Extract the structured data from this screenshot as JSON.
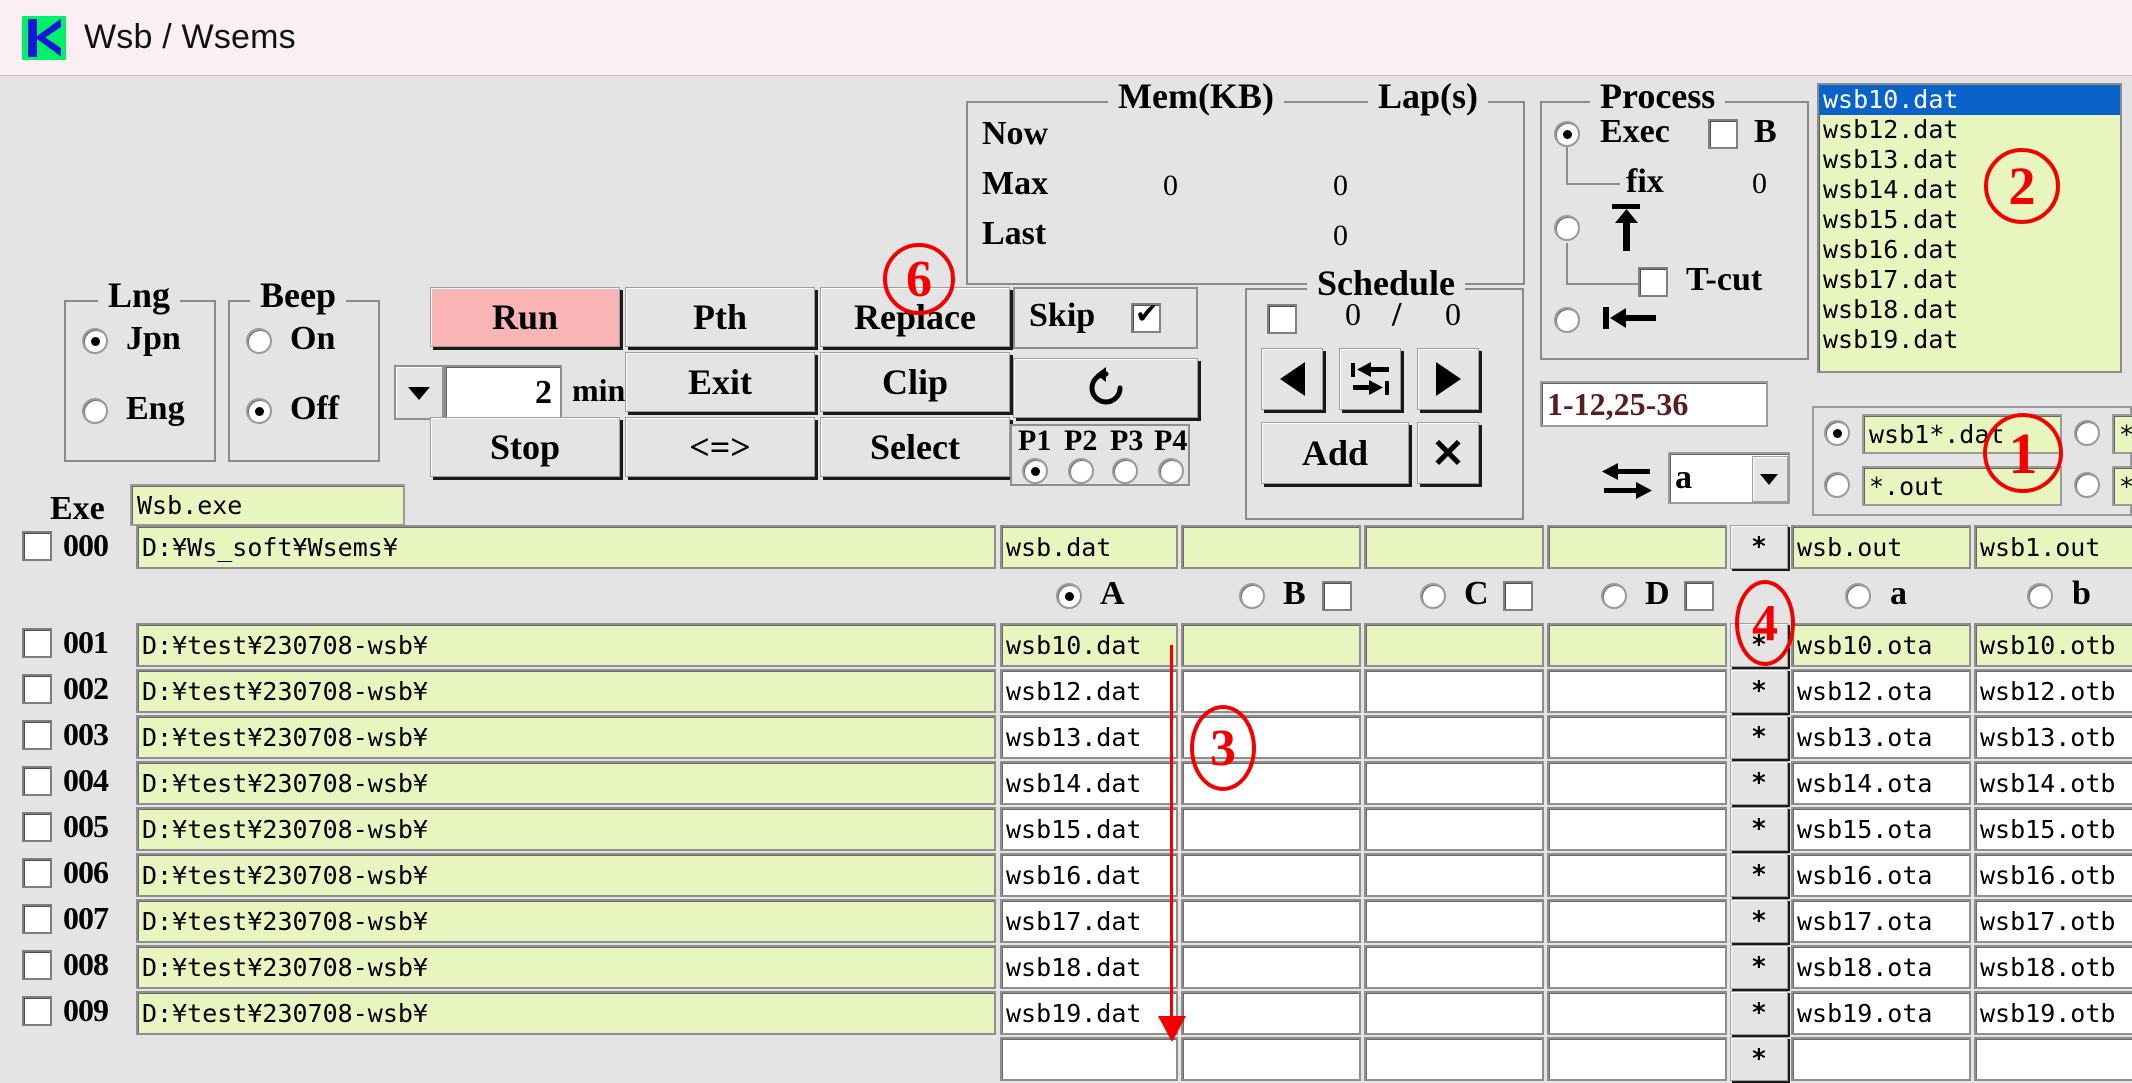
{
  "window": {
    "title": "Wsb / Wsems",
    "logo_icon": "k-logo-icon"
  },
  "mem_lap": {
    "title_mem": "Mem(KB)",
    "title_lap": "Lap(s)",
    "rows": [
      {
        "label": "Now",
        "mem": "",
        "lap": ""
      },
      {
        "label": "Max",
        "mem": "0",
        "lap": "0"
      },
      {
        "label": "Last",
        "mem": "",
        "lap": "0"
      }
    ]
  },
  "process": {
    "title": "Process",
    "exec_label": "Exec",
    "exec_selected": true,
    "b_label": "B",
    "b_checked": false,
    "fix_label": "fix",
    "fix_value": "0",
    "up_icon": "up-arrow-bar-icon",
    "up_selected": false,
    "tcut_label": "T-cut",
    "tcut_checked": false,
    "home_icon": "bar-left-arrow-icon",
    "home_selected": false,
    "range_value": "1-12,25-36",
    "swap_icon": "swap-arrows-icon",
    "suffix_value": "a"
  },
  "filelist": {
    "items": [
      "wsb10.dat",
      "wsb12.dat",
      "wsb13.dat",
      "wsb14.dat",
      "wsb15.dat",
      "wsb16.dat",
      "wsb17.dat",
      "wsb18.dat",
      "wsb19.dat"
    ],
    "selected_index": 0
  },
  "lng": {
    "title": "Lng",
    "options": [
      "Jpn",
      "Eng"
    ],
    "selected": "Jpn"
  },
  "beep": {
    "title": "Beep",
    "options": [
      "On",
      "Off"
    ],
    "selected": "Off"
  },
  "exe": {
    "label": "Exe",
    "value": "Wsb.exe"
  },
  "buttons": {
    "run": "Run",
    "pth": "Pth",
    "replace": "Replace",
    "exit": "Exit",
    "clip": "Clip",
    "stop": "Stop",
    "swap": "<=>",
    "select": "Select",
    "refresh_icon": "refresh-icon"
  },
  "timer": {
    "dropdown_icon": "chevron-down-icon",
    "value": "2",
    "unit": "min"
  },
  "skip": {
    "label": "Skip",
    "checked": true
  },
  "pset": {
    "options": [
      "P1",
      "P2",
      "P3",
      "P4"
    ],
    "selected": "P1"
  },
  "schedule": {
    "title": "Schedule",
    "enabled": false,
    "current": "0",
    "separator": "/",
    "total": "0",
    "prev_icon": "triangle-left-icon",
    "swap_icon": "swap-ends-icon",
    "next_icon": "triangle-right-icon",
    "add_label": "Add",
    "delete_icon": "x-icon"
  },
  "filter": {
    "rows": [
      {
        "pattern": "wsb1*.dat",
        "selected": true,
        "alt_selected": false,
        "alt_pattern": "*"
      },
      {
        "pattern": "*.out",
        "selected": false,
        "alt_selected": false,
        "alt_pattern": "*"
      }
    ]
  },
  "table": {
    "column_headers": {
      "a": "A",
      "b": "B",
      "c": "C",
      "d": "D",
      "a_selected": true,
      "b_selected": false,
      "c_selected": false,
      "d_selected": false,
      "b_checked": false,
      "c_checked": false,
      "d_checked": false,
      "out_a": "a",
      "out_b": "b",
      "out_a_selected": false,
      "out_b_selected": false
    },
    "header_row": {
      "no": "000",
      "checked": false,
      "path": "D:¥Ws_soft¥Wsems¥",
      "colA": "wsb.dat",
      "colB": "",
      "colC": "",
      "colD": "",
      "star": "*",
      "outA": "wsb.out",
      "outB": "wsb1.out",
      "highlight": true
    },
    "rows": [
      {
        "no": "001",
        "checked": false,
        "path": "D:¥test¥230708-wsb¥",
        "colA": "wsb10.dat",
        "colB": "",
        "colC": "",
        "colD": "",
        "star": "*",
        "outA": "wsb10.ota",
        "outB": "wsb10.otb",
        "highlight": true
      },
      {
        "no": "002",
        "checked": false,
        "path": "D:¥test¥230708-wsb¥",
        "colA": "wsb12.dat",
        "colB": "",
        "colC": "",
        "colD": "",
        "star": "*",
        "outA": "wsb12.ota",
        "outB": "wsb12.otb",
        "highlight": false
      },
      {
        "no": "003",
        "checked": false,
        "path": "D:¥test¥230708-wsb¥",
        "colA": "wsb13.dat",
        "colB": "",
        "colC": "",
        "colD": "",
        "star": "*",
        "outA": "wsb13.ota",
        "outB": "wsb13.otb",
        "highlight": false
      },
      {
        "no": "004",
        "checked": false,
        "path": "D:¥test¥230708-wsb¥",
        "colA": "wsb14.dat",
        "colB": "",
        "colC": "",
        "colD": "",
        "star": "*",
        "outA": "wsb14.ota",
        "outB": "wsb14.otb",
        "highlight": false
      },
      {
        "no": "005",
        "checked": false,
        "path": "D:¥test¥230708-wsb¥",
        "colA": "wsb15.dat",
        "colB": "",
        "colC": "",
        "colD": "",
        "star": "*",
        "outA": "wsb15.ota",
        "outB": "wsb15.otb",
        "highlight": false
      },
      {
        "no": "006",
        "checked": false,
        "path": "D:¥test¥230708-wsb¥",
        "colA": "wsb16.dat",
        "colB": "",
        "colC": "",
        "colD": "",
        "star": "*",
        "outA": "wsb16.ota",
        "outB": "wsb16.otb",
        "highlight": false
      },
      {
        "no": "007",
        "checked": false,
        "path": "D:¥test¥230708-wsb¥",
        "colA": "wsb17.dat",
        "colB": "",
        "colC": "",
        "colD": "",
        "star": "*",
        "outA": "wsb17.ota",
        "outB": "wsb17.otb",
        "highlight": false
      },
      {
        "no": "008",
        "checked": false,
        "path": "D:¥test¥230708-wsb¥",
        "colA": "wsb18.dat",
        "colB": "",
        "colC": "",
        "colD": "",
        "star": "*",
        "outA": "wsb18.ota",
        "outB": "wsb18.otb",
        "highlight": false
      },
      {
        "no": "009",
        "checked": false,
        "path": "D:¥test¥230708-wsb¥",
        "colA": "wsb19.dat",
        "colB": "",
        "colC": "",
        "colD": "",
        "star": "*",
        "outA": "wsb19.ota",
        "outB": "wsb19.otb",
        "highlight": false
      },
      {
        "no": "",
        "checked": false,
        "path": "",
        "colA": "",
        "colB": "",
        "colC": "",
        "colD": "",
        "star": "*",
        "outA": "",
        "outB": "",
        "highlight": false
      }
    ]
  },
  "annotations": [
    {
      "id": "1",
      "label": "1"
    },
    {
      "id": "2",
      "label": "2"
    },
    {
      "id": "3",
      "label": "3"
    },
    {
      "id": "4",
      "label": "4"
    },
    {
      "id": "6",
      "label": "6"
    }
  ],
  "colors": {
    "field_green": "#e9f5bf",
    "run_pink": "#f9b5b5",
    "select_blue": "#0a63c8",
    "annotation_red": "#f50000"
  }
}
